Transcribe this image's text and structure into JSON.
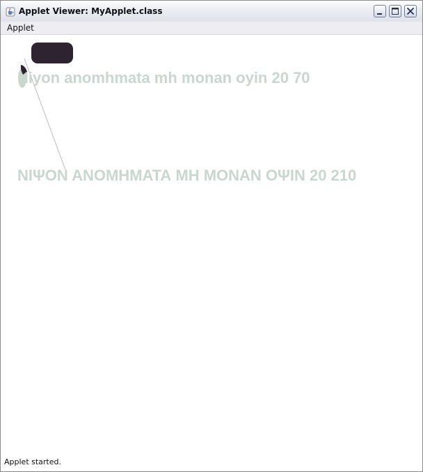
{
  "window": {
    "title": "Applet Viewer: MyApplet.class",
    "icon": "java-cup-icon",
    "controls": [
      "minimize-icon",
      "maximize-icon",
      "close-icon"
    ]
  },
  "menubar": {
    "items": [
      {
        "label": "Applet"
      }
    ]
  },
  "applet": {
    "text_lower": "Niyon anomhmata mh monan oyin 20 70",
    "text_upper": "ΝΙΨΟΝ ΑΝΟΜΗΜΑΤΑ ΜΗ ΜΟΝΑΝ ΟΨΙΝ 20 210",
    "text_color": "#c9d8cf",
    "shape_color": "#2e2331",
    "line_color": "#bdbdbd"
  },
  "status": {
    "text": "Applet started."
  }
}
